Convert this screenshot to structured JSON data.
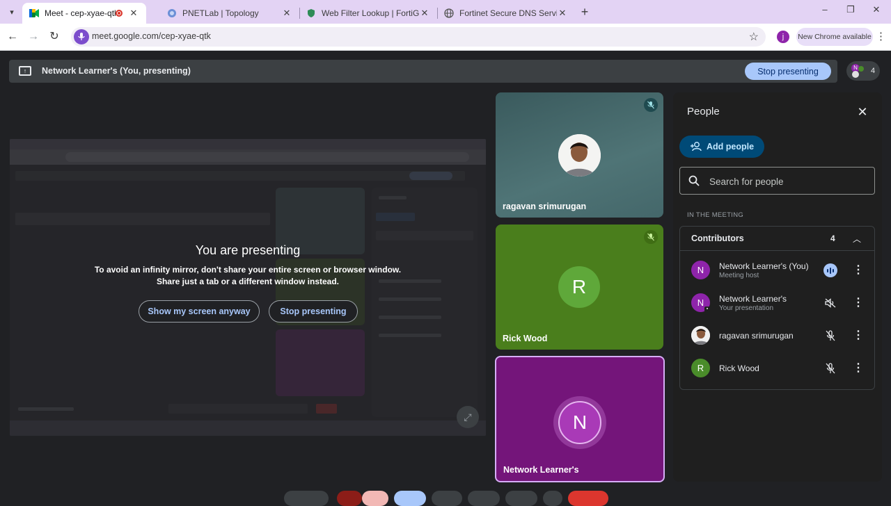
{
  "browser": {
    "tabs": [
      {
        "title": "Meet - cep-xyae-qtk",
        "active": true,
        "recording": true
      },
      {
        "title": "PNETLab | Topology",
        "active": false
      },
      {
        "title": "Web Filter Lookup | FortiGuard",
        "active": false
      },
      {
        "title": "Fortinet Secure DNS Service Po",
        "active": false
      }
    ],
    "url": "meet.google.com/cep-xyae-qtk",
    "profile_initial": "j",
    "update_badge": "New Chrome available",
    "window_controls": {
      "minimize": "–",
      "restore": "❐",
      "close": "✕"
    }
  },
  "meet": {
    "presenting_bar": {
      "title": "Network Learner's (You, presenting)",
      "stop_button": "Stop presenting",
      "participant_count": "4",
      "avatar_initial": "N"
    },
    "shared_screen": {
      "heading": "You are presenting",
      "message_line1": "To avoid an infinity mirror, don't share your entire screen or browser window.",
      "message_line2": "Share just a tab or a different window instead.",
      "show_button": "Show my screen anyway",
      "stop_button": "Stop presenting"
    },
    "tiles": [
      {
        "name": "ragavan srimurugan",
        "type": "photo",
        "muted": true
      },
      {
        "name": "Rick Wood",
        "initial": "R",
        "color": "#4a7e1c",
        "muted": true
      },
      {
        "name": "Network Learner's",
        "initial": "N",
        "color": "#74157a",
        "highlighted": true
      }
    ],
    "people_panel": {
      "title": "People",
      "add_people": "Add people",
      "search_placeholder": "Search for people",
      "section_label": "IN THE MEETING",
      "group_label": "Contributors",
      "group_count": "4",
      "people": [
        {
          "name": "Network Learner's (You)",
          "subtitle": "Meeting host",
          "initial": "N",
          "color": "#8e24aa",
          "status": "speaking-icon"
        },
        {
          "name": "Network Learner's",
          "subtitle": "Your presentation",
          "initial": "N",
          "color": "#8e24aa",
          "status": "volume-off-icon"
        },
        {
          "name": "ragavan srimurugan",
          "subtitle": "",
          "initial": "",
          "color": "#e0e0e0",
          "status": "mic-off-icon"
        },
        {
          "name": "Rick Wood",
          "subtitle": "",
          "initial": "R",
          "color": "#4a8c2a",
          "status": "mic-off-icon"
        }
      ]
    }
  },
  "colors": {
    "accent_blue": "#a8c7fa",
    "panel_bg": "#1f1f1f",
    "meet_bg": "#202124",
    "highlight_border": "#d7aef7"
  }
}
